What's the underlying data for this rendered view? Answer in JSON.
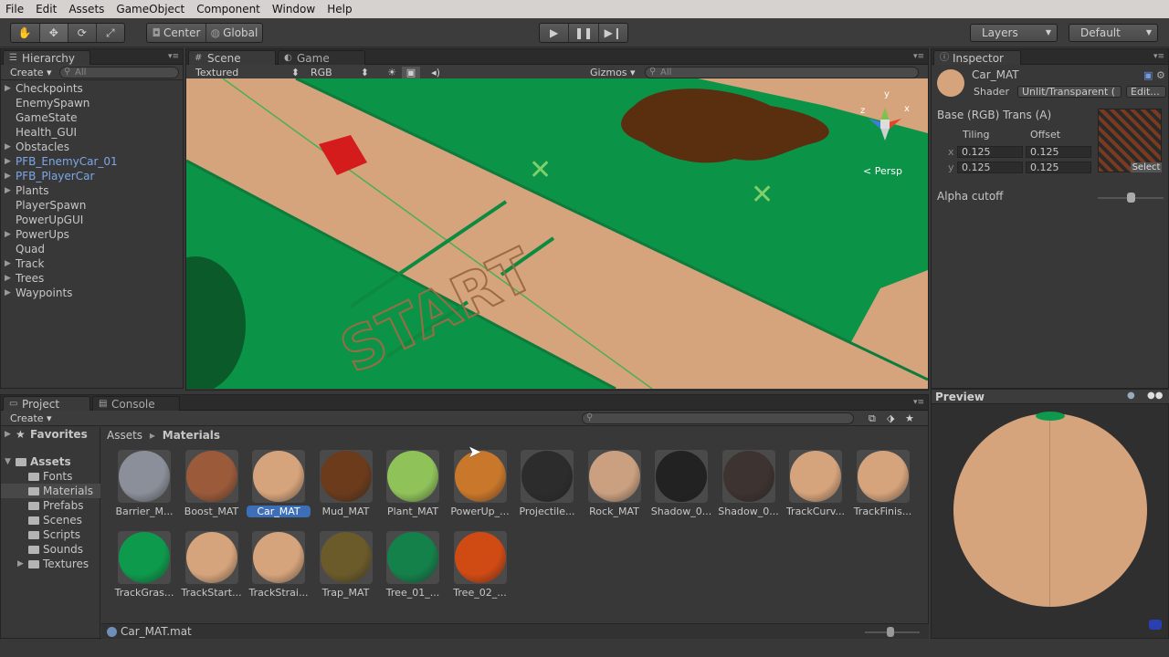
{
  "menu": [
    "File",
    "Edit",
    "Assets",
    "GameObject",
    "Component",
    "Window",
    "Help"
  ],
  "toolbar": {
    "pivot": "Center",
    "space": "Global",
    "layers": "Layers",
    "layout": "Default"
  },
  "hierarchy": {
    "tab": "Hierarchy",
    "create": "Create",
    "search_placeholder": "All",
    "items": [
      {
        "label": "Checkpoints",
        "expandable": true,
        "prefab": false
      },
      {
        "label": "EnemySpawn",
        "expandable": false,
        "prefab": false
      },
      {
        "label": "GameState",
        "expandable": false,
        "prefab": false
      },
      {
        "label": "Health_GUI",
        "expandable": false,
        "prefab": false
      },
      {
        "label": "Obstacles",
        "expandable": true,
        "prefab": false
      },
      {
        "label": "PFB_EnemyCar_01",
        "expandable": true,
        "prefab": true
      },
      {
        "label": "PFB_PlayerCar",
        "expandable": true,
        "prefab": true
      },
      {
        "label": "Plants",
        "expandable": true,
        "prefab": false
      },
      {
        "label": "PlayerSpawn",
        "expandable": false,
        "prefab": false
      },
      {
        "label": "PowerUpGUI",
        "expandable": false,
        "prefab": false
      },
      {
        "label": "PowerUps",
        "expandable": true,
        "prefab": false
      },
      {
        "label": "Quad",
        "expandable": false,
        "prefab": false
      },
      {
        "label": "Track",
        "expandable": true,
        "prefab": false
      },
      {
        "label": "Trees",
        "expandable": true,
        "prefab": false
      },
      {
        "label": "Waypoints",
        "expandable": true,
        "prefab": false
      }
    ]
  },
  "scene": {
    "tabs": [
      "Scene",
      "Game"
    ],
    "render_mode": "Textured",
    "channel": "RGB",
    "gizmos": "Gizmos",
    "search_placeholder": "All",
    "persp": "Persp",
    "start_text": "START",
    "axis": {
      "y": "y",
      "x": "x",
      "z": "z"
    }
  },
  "inspector": {
    "tab": "Inspector",
    "name": "Car_MAT",
    "shader_label": "Shader",
    "shader_value": "Unlit/Transparent (",
    "edit_btn": "Edit...",
    "texture_label": "Base (RGB) Trans (A)",
    "tiling_label": "Tiling",
    "offset_label": "Offset",
    "x_label": "x",
    "y_label": "y",
    "tiling_x": "0.125",
    "tiling_y": "0.125",
    "offset_x": "0.125",
    "offset_y": "0.125",
    "select_btn": "Select",
    "alpha_label": "Alpha cutoff",
    "alpha_value": 0.5
  },
  "project": {
    "tabs": [
      "Project",
      "Console"
    ],
    "create": "Create",
    "favorites": "Favorites",
    "assets_root": "Assets",
    "folders": [
      "Fonts",
      "Materials",
      "Prefabs",
      "Scenes",
      "Scripts",
      "Sounds",
      "Textures"
    ],
    "selected_folder": "Materials",
    "breadcrumb": [
      "Assets",
      "Materials"
    ],
    "breadcrumb_sep": "▸",
    "assets": [
      {
        "label": "Barrier_M...",
        "color": "#8a8f99"
      },
      {
        "label": "Boost_MAT",
        "color": "#9b5a3a"
      },
      {
        "label": "Car_MAT",
        "color": "#d6a47c",
        "selected": true
      },
      {
        "label": "Mud_MAT",
        "color": "#6b3b1c"
      },
      {
        "label": "Plant_MAT",
        "color": "#8fc35a"
      },
      {
        "label": "PowerUp_...",
        "color": "#c9772a"
      },
      {
        "label": "Projectile...",
        "color": "#2c2c2c"
      },
      {
        "label": "Rock_MAT",
        "color": "#caa080"
      },
      {
        "label": "Shadow_0...",
        "color": "#222222"
      },
      {
        "label": "Shadow_0...",
        "color": "#3d3330"
      },
      {
        "label": "TrackCurv...",
        "color": "#d6a47c"
      },
      {
        "label": "TrackFinis...",
        "color": "#d6a47c"
      },
      {
        "label": "TrackGras...",
        "color": "#0e9a4c"
      },
      {
        "label": "TrackStart...",
        "color": "#d6a47c"
      },
      {
        "label": "TrackStrai...",
        "color": "#d6a47c"
      },
      {
        "label": "Trap_MAT",
        "color": "#6b5a2a"
      },
      {
        "label": "Tree_01_...",
        "color": "#14804a"
      },
      {
        "label": "Tree_02_...",
        "color": "#d04a14"
      }
    ],
    "status_file": "Car_MAT.mat"
  },
  "preview": {
    "title": "Preview",
    "sphere_color": "#d6a47c"
  }
}
